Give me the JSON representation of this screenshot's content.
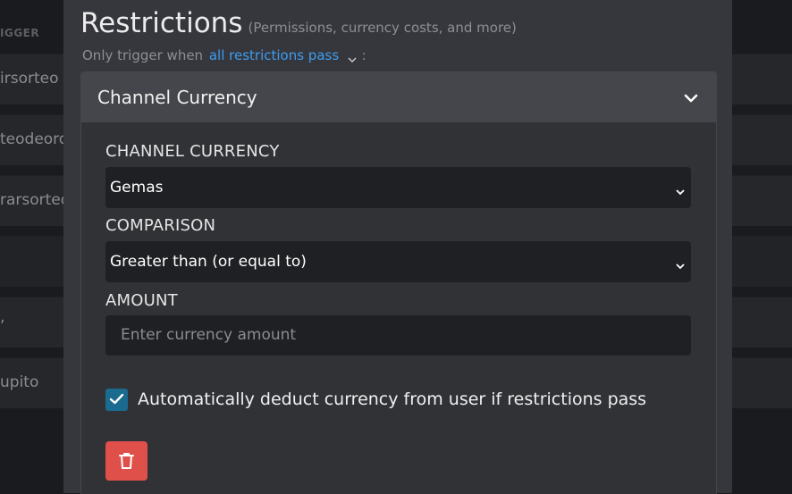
{
  "background": {
    "column_header": "IGGER",
    "rows": [
      {
        "text": "irsorteo"
      },
      {
        "text": "teodeoro"
      },
      {
        "text": "rarsorteo"
      },
      {
        "text": ""
      },
      {
        "text": ","
      },
      {
        "text": "upito"
      }
    ]
  },
  "modal": {
    "title": "Restrictions",
    "subtitle": "(Permissions, currency costs, and more)",
    "trigger_prefix": "Only trigger when",
    "trigger_mode": "all restrictions pass",
    "trigger_suffix": ":"
  },
  "panel": {
    "title": "Channel Currency",
    "currency_label": "CHANNEL CURRENCY",
    "currency_value": "Gemas",
    "comparison_label": "COMPARISON",
    "comparison_value": "Greater than (or equal to)",
    "amount_label": "AMOUNT",
    "amount_placeholder": "Enter currency amount",
    "amount_value": "",
    "deduct_label": "Automatically deduct currency from user if restrictions pass",
    "deduct_checked": true
  },
  "icons": {
    "trigger_dropdown": "chevron-down-icon",
    "panel_collapse": "chevron-down-icon",
    "select_dropdown": "chevron-down-icon",
    "checkbox": "check-icon",
    "delete": "trash-icon"
  },
  "colors": {
    "accent_link": "#3d9cf0",
    "checkbox_fill": "#1a6b8f",
    "danger": "#e0504b",
    "modal_bg": "#36373c",
    "input_bg": "#1f2023"
  }
}
